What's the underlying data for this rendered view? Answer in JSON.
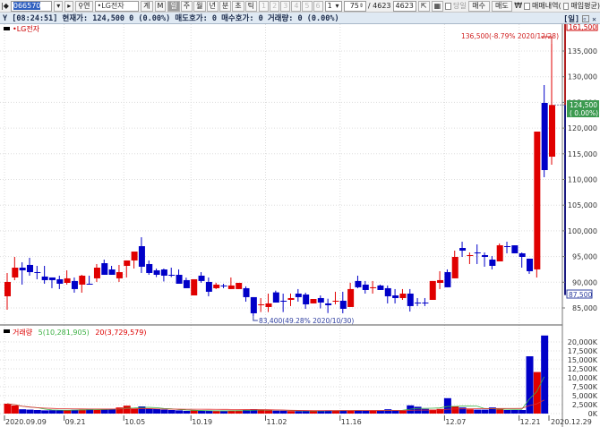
{
  "toolbar": {
    "code": "066570",
    "name": "•LG전자",
    "btn_a": "계",
    "btn_b": "M",
    "search_label": "연",
    "periods": [
      "일",
      "주",
      "월",
      "년",
      "분",
      "초",
      "틱"
    ],
    "selected_period": "일",
    "nums": [
      "1",
      "2",
      "3",
      "4",
      "5",
      "6"
    ],
    "interval": "1",
    "count": "75",
    "total": "/ 4623",
    "total2": "4623",
    "today": "당일",
    "buy": "매수",
    "sell": "매도",
    "won": "₩",
    "trades": "매매내역(",
    "avg": "매입평균)"
  },
  "info": {
    "text": "Y [08:24:51] 현재가: 124,500 0 (0.00%) 매도호가: 0 매수호가: 0 거래량: 0 (0.00%)",
    "period": "[일]"
  },
  "colors": {
    "up": "#e00000",
    "down": "#0000c8",
    "ma5": "#3cb043",
    "ma20": "#e03030",
    "range": "#1a1a80"
  },
  "chart_data": [
    {
      "type": "candlestick",
      "title": "•LG전자",
      "yaxis_ticks": [
        "85,000",
        "90,000",
        "95,000",
        "100,000",
        "105,000",
        "110,000",
        "115,000",
        "120,000",
        "125,000",
        "130,000",
        "135,000"
      ],
      "ylim": [
        80000,
        140000
      ],
      "x_labels": [
        "2020.09.09",
        "09.21",
        "10.05",
        "10.19",
        "11.02",
        "11.16",
        "12.07",
        "12.21",
        "2020.12.29"
      ],
      "x_label_index": [
        0,
        8,
        16,
        25,
        35,
        45,
        59,
        69,
        73
      ],
      "ohlc": [
        [
          87270,
          91800,
          84650,
          90060
        ],
        [
          90930,
          94930,
          90400,
          92840
        ],
        [
          92840,
          93890,
          89540,
          92320
        ],
        [
          93370,
          94760,
          91280,
          91970
        ],
        [
          91970,
          93190,
          90580,
          91800
        ],
        [
          91110,
          93190,
          89710,
          90410
        ],
        [
          90930,
          90930,
          88840,
          90410
        ],
        [
          90580,
          91280,
          88670,
          89710
        ],
        [
          89880,
          92320,
          89540,
          90760
        ],
        [
          90240,
          90930,
          87970,
          88670
        ],
        [
          89540,
          91450,
          87970,
          91280
        ],
        [
          89710,
          91280,
          89540,
          89540
        ],
        [
          90760,
          93540,
          90060,
          92840
        ],
        [
          93710,
          94410,
          91450,
          91450
        ],
        [
          92490,
          93190,
          91450,
          91450
        ],
        [
          90760,
          93370,
          90060,
          91970
        ],
        [
          93190,
          94240,
          90930,
          94240
        ],
        [
          94240,
          95100,
          92670,
          95970
        ],
        [
          97020,
          98760,
          91800,
          93020
        ],
        [
          93540,
          94240,
          91450,
          91800
        ],
        [
          92320,
          92670,
          91000,
          91450
        ],
        [
          92490,
          92670,
          90150,
          91280
        ],
        [
          91450,
          92840,
          91000,
          91280
        ],
        [
          91450,
          92500,
          90200,
          89710
        ],
        [
          90410,
          90900,
          88840,
          88840
        ],
        [
          87440,
          90580,
          87440,
          90580
        ],
        [
          91280,
          91970,
          89900,
          90240
        ],
        [
          90060,
          90930,
          87270,
          88150
        ],
        [
          88840,
          89900,
          88670,
          89540
        ],
        [
          89370,
          89700,
          88840,
          89190
        ],
        [
          88670,
          90930,
          88670,
          89370
        ],
        [
          88670,
          89880,
          88670,
          89880
        ],
        [
          88840,
          89200,
          86220,
          87100
        ],
        [
          87100,
          87100,
          83400,
          83960
        ],
        [
          85530,
          86920,
          84200,
          85700
        ],
        [
          85180,
          87790,
          84200,
          85880
        ],
        [
          88030,
          88370,
          86050,
          86050
        ],
        [
          86400,
          87790,
          84200,
          86220
        ],
        [
          86570,
          87800,
          85360,
          86920
        ],
        [
          87790,
          88670,
          86220,
          87100
        ],
        [
          87610,
          87970,
          84820,
          85700
        ],
        [
          85880,
          86400,
          85880,
          86740
        ],
        [
          86920,
          87440,
          84900,
          86050
        ],
        [
          85880,
          86800,
          84000,
          85530
        ],
        [
          86220,
          88150,
          85700,
          86400
        ],
        [
          86400,
          88150,
          83960,
          84830
        ],
        [
          85180,
          89900,
          85180,
          88670
        ],
        [
          90240,
          91280,
          88840,
          89020
        ],
        [
          89540,
          90240,
          87790,
          88490
        ],
        [
          88840,
          90240,
          87790,
          89020
        ],
        [
          89370,
          89540,
          88490,
          88490
        ],
        [
          88840,
          89370,
          85880,
          87270
        ],
        [
          87440,
          88670,
          85880,
          86920
        ],
        [
          86920,
          88670,
          86570,
          87790
        ],
        [
          87790,
          88670,
          84300,
          85360
        ],
        [
          86050,
          86920,
          85360,
          85880
        ],
        [
          86050,
          86920,
          85360,
          85880
        ],
        [
          86570,
          90240,
          86570,
          90240
        ],
        [
          89880,
          92150,
          88670,
          90410
        ],
        [
          91970,
          92500,
          89020,
          89020
        ],
        [
          90760,
          96150,
          90760,
          94930
        ],
        [
          96670,
          97890,
          94930,
          96150
        ],
        [
          95110,
          95800,
          93540,
          95280
        ],
        [
          95800,
          97370,
          93540,
          95630
        ],
        [
          95280,
          95800,
          93020,
          94930
        ],
        [
          94410,
          95110,
          92500,
          93190
        ],
        [
          94060,
          97540,
          94060,
          97190
        ],
        [
          97020,
          97890,
          95630,
          96850
        ],
        [
          97190,
          97190,
          95630,
          95630
        ],
        [
          95630,
          95800,
          92840,
          94930
        ],
        [
          94590,
          94590,
          91630,
          92150
        ],
        [
          92500,
          119320,
          90930,
          119320
        ],
        [
          124900,
          128380,
          110440,
          111830
        ],
        [
          114440,
          136500,
          112880,
          124500
        ]
      ],
      "annotations": {
        "high": "136,500(-8.79% 2020/12/28)",
        "low": "83,400(49.28% 2020/10/30)"
      },
      "range_labels": {
        "max": "161,500",
        "current": "124,500",
        "current_change": "( 0.00%)",
        "min": "87,500"
      },
      "range": {
        "max": 161500,
        "min": 87500,
        "current": 124500
      }
    },
    {
      "type": "bar",
      "title": "거래량",
      "legend": [
        "거래량",
        "5(10,281,905)",
        "20(3,729,579)"
      ],
      "unit": "K",
      "yaxis_ticks": [
        "0K",
        "2,500K",
        "5,000K",
        "7,500K",
        "10,000K",
        "12,500K",
        "15,000K",
        "17,500K",
        "20,000K"
      ],
      "ylim": [
        0,
        22500
      ],
      "volume_k": [
        2750,
        2250,
        1200,
        1100,
        1000,
        900,
        950,
        900,
        1000,
        1050,
        1150,
        1200,
        1100,
        1200,
        1300,
        1700,
        2200,
        1400,
        2000,
        1400,
        1250,
        1100,
        1000,
        900,
        750,
        850,
        800,
        800,
        700,
        700,
        900,
        900,
        1000,
        1200,
        1000,
        900,
        800,
        800,
        700,
        700,
        800,
        750,
        800,
        900,
        800,
        900,
        800,
        900,
        800,
        850,
        800,
        1200,
        900,
        900,
        2300,
        1900,
        1300,
        1100,
        1300,
        4300,
        2000,
        1700,
        1200,
        1100,
        1100,
        1700,
        1200,
        1000,
        1000,
        1000,
        16000,
        11600,
        21800
      ]
    }
  ]
}
